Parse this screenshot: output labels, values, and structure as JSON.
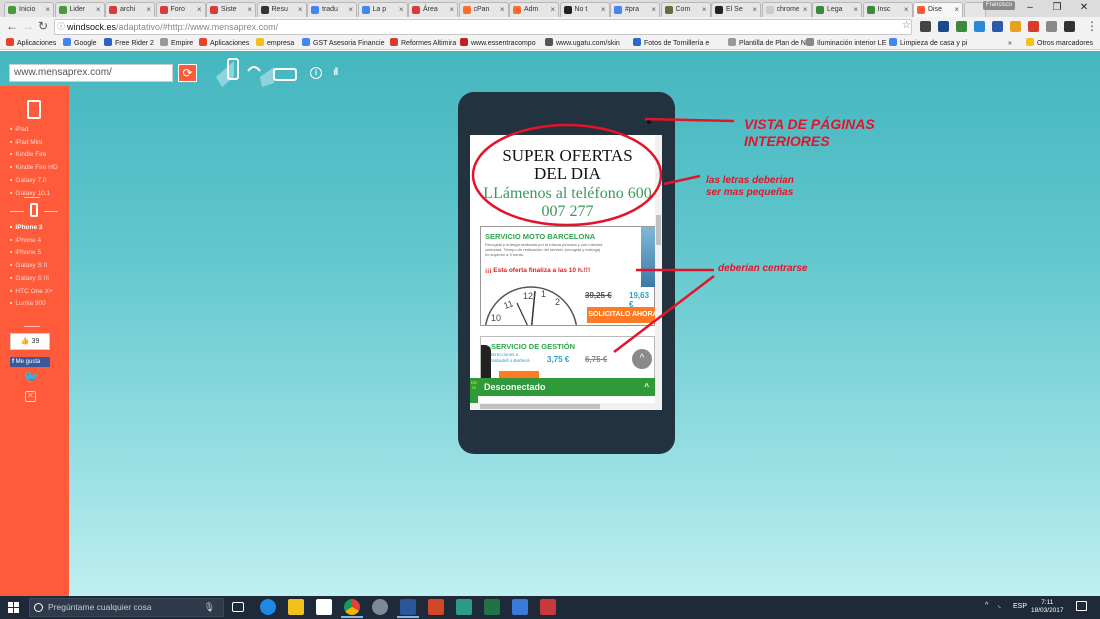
{
  "browser": {
    "tabs": [
      {
        "label": "Inicio",
        "color": "#4a9a3a"
      },
      {
        "label": "Lider",
        "color": "#4a9a3a"
      },
      {
        "label": "archi",
        "color": "#d93b3b"
      },
      {
        "label": "Foro",
        "color": "#d93b3b"
      },
      {
        "label": "Siste",
        "color": "#d93b3b"
      },
      {
        "label": "Resu",
        "color": "#333333"
      },
      {
        "label": "tradu",
        "color": "#4285f4"
      },
      {
        "label": "La p",
        "color": "#4285f4"
      },
      {
        "label": "Área",
        "color": "#d93b3b"
      },
      {
        "label": "cPan",
        "color": "#ff6c2c"
      },
      {
        "label": "Adm",
        "color": "#ff6c2c"
      },
      {
        "label": "No t",
        "color": "#222222"
      },
      {
        "label": "#pra",
        "color": "#4285f4"
      },
      {
        "label": "Com",
        "color": "#6a6a3a"
      },
      {
        "label": "El Se",
        "color": "#222222"
      },
      {
        "label": "chrome",
        "color": "#cccccc"
      },
      {
        "label": "Lega",
        "color": "#3a8a3a"
      },
      {
        "label": "Insc",
        "color": "#3a8a3a"
      },
      {
        "label": "Dise",
        "color": "#ff5a3a",
        "active": true
      }
    ],
    "profile_badge": "Francisco",
    "url": "windsock.es/adaptativo/#http://www.mensaprex.com/",
    "url_host": "windsock.es",
    "url_path": "/adaptativo/#http://www.mensaprex.com/",
    "bookmarks": [
      {
        "label": "Aplicaciones",
        "color": "#e8442c"
      },
      {
        "label": "Google",
        "color": "#4285f4"
      },
      {
        "label": "Free Rider 2",
        "color": "#3060c0"
      },
      {
        "label": "Empire",
        "color": "#999999"
      },
      {
        "label": "Aplicaciones",
        "color": "#e8442c"
      },
      {
        "label": "empresa",
        "color": "#f2c21b"
      },
      {
        "label": "GST Asesoria Financie",
        "color": "#4285f4"
      },
      {
        "label": "Reformes Altimira",
        "color": "#d83b2b"
      },
      {
        "label": "www.essentracompo",
        "color": "#c02020"
      },
      {
        "label": "www.ugatu.com/skin",
        "color": "#555555"
      },
      {
        "label": "Fotos de Tornillería e",
        "color": "#2a6ac8"
      },
      {
        "label": "Plantilla de Plan de N",
        "color": "#999999"
      },
      {
        "label": "Iluminación interior LE",
        "color": "#888888"
      },
      {
        "label": "Limpieza de casa y pi",
        "color": "#4285f4"
      }
    ],
    "bookmarks_more": "»",
    "other_bookmarks": "Otros marcadores"
  },
  "tool": {
    "url_input_value": "www.mensaprex.com/",
    "refresh_icon": "refresh-icon",
    "info_icon": "info-icon",
    "sidebar": {
      "tablets": [
        "iPad",
        "iPad Mini",
        "Kindle Fire",
        "Kindle Fire HD",
        "Galaxy 7.0",
        "Galaxy 10.1"
      ],
      "phones": [
        "iPhone 3",
        "iPhone 4",
        "iPhone 5",
        "Galaxy S II",
        "Galaxy S III",
        "HTC One X+",
        "Lumia 900"
      ],
      "active_phone": "iPhone 3",
      "like_count": "39",
      "fb_like_label": "Me gusta"
    }
  },
  "preview": {
    "headline_line1": "SUPER OFERTAS",
    "headline_line2": "DEL DIA",
    "headline_green": "LLámenos al teléfono 600 007 277",
    "moto": {
      "title": "SERVICIO MOTO BARCELONA",
      "description": "Recogida y entrega realizada por la misma persona y con máxima celeridad. Tiempo de realización del servicio (recogida y entrega) no superior a 3 horas.",
      "offer": "¡¡¡ Esta oferta finaliza a las 10 h.!!!",
      "old_price": "39,25 €",
      "new_price": "19,63 €",
      "button": "SOLICITALO AHORA"
    },
    "gestion": {
      "title": "SERVICIO DE GESTIÓN",
      "subtitle_1": "Direcciones a",
      "subtitle_2": "Sabadell o Barberà",
      "price": "3,75 €",
      "old_price": "6,75 €"
    },
    "chat_label": "Desconectado",
    "chat_chevron": "^",
    "scroll_top_icon": "^"
  },
  "annotations": {
    "vista_line1": "VISTA DE PÁGINAS",
    "vista_line2": "INTERIORES",
    "letras_line1": "las letras deberian",
    "letras_line2": "ser mas pequeñas",
    "centrar": "deberian centrarse",
    "color": "#e5132a"
  },
  "taskbar": {
    "search_placeholder": "Pregúntame cualquier cosa",
    "language": "ESP",
    "time": "7:11",
    "date": "18/03/2017"
  }
}
